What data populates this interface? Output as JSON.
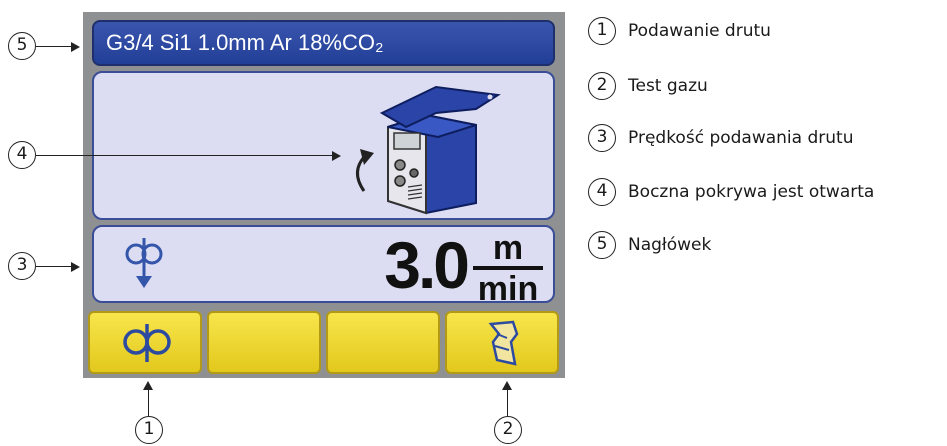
{
  "screen": {
    "header_text": "G3/4 Si1 1.0mm Ar 18%CO₂",
    "speed": {
      "value": "3.0",
      "unit_top": "m",
      "unit_bottom": "min"
    },
    "status_icon": "open-side-cover-icon",
    "softkeys": [
      {
        "icon": "wire-feed-icon"
      },
      {
        "icon": ""
      },
      {
        "icon": ""
      },
      {
        "icon": "gas-test-icon"
      }
    ],
    "colors": {
      "header": "#223f97",
      "panel": "#dcdcf2",
      "softkey": "#e9d12e",
      "bezel": "#8f9091"
    }
  },
  "callouts": {
    "c1": "1",
    "c2": "2",
    "c3": "3",
    "c4": "4",
    "c5": "5"
  },
  "legend": [
    {
      "num": "1",
      "text": "Podawanie drutu"
    },
    {
      "num": "2",
      "text": "Test gazu"
    },
    {
      "num": "3",
      "text": "Prędkość podawania drutu"
    },
    {
      "num": "4",
      "text": "Boczna pokrywa jest otwarta"
    },
    {
      "num": "5",
      "text": "Nagłówek"
    }
  ]
}
